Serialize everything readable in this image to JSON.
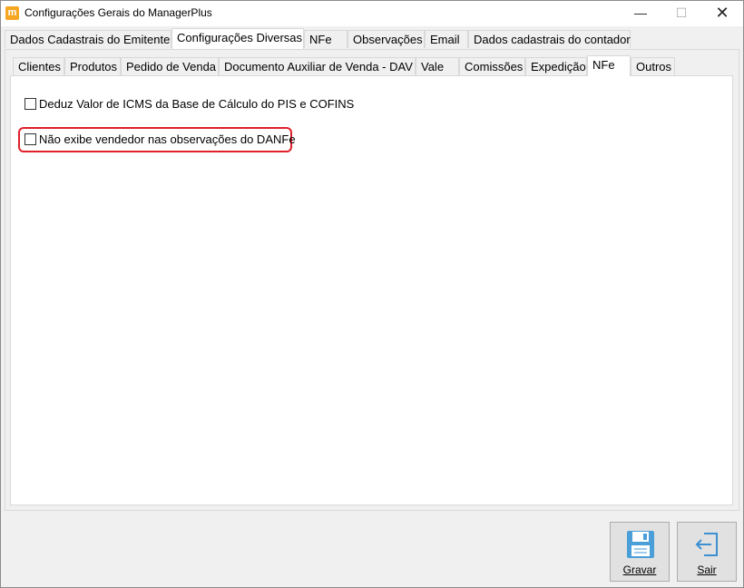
{
  "window": {
    "title": "Configurações Gerais do ManagerPlus",
    "icon": "managerplus-app-icon",
    "controls": [
      "minimize",
      "maximize",
      "close"
    ]
  },
  "main_tabs": [
    {
      "label": "Dados Cadastrais do Emitente",
      "active": false
    },
    {
      "label": "Configurações Diversas",
      "active": true
    },
    {
      "label": "NFe",
      "active": false
    },
    {
      "label": "Observações",
      "active": false
    },
    {
      "label": "Email",
      "active": false
    },
    {
      "label": "Dados cadastrais do contador",
      "active": false
    }
  ],
  "sub_tabs": [
    {
      "label": "Clientes",
      "active": false
    },
    {
      "label": "Produtos",
      "active": false
    },
    {
      "label": "Pedido de Venda",
      "active": false
    },
    {
      "label": "Documento Auxiliar de Venda - DAV",
      "active": false
    },
    {
      "label": "Vale",
      "active": false
    },
    {
      "label": "Comissões",
      "active": false
    },
    {
      "label": "Expedição",
      "active": false
    },
    {
      "label": "NFe",
      "active": true
    },
    {
      "label": "Outros",
      "active": false
    }
  ],
  "options": [
    {
      "label": "Deduz Valor de ICMS da Base de Cálculo do PIS e COFINS",
      "checked": false
    },
    {
      "label": "Não exibe vendedor nas observações do DANFe",
      "checked": false,
      "highlighted": true
    }
  ],
  "buttons": {
    "save": {
      "label": "Gravar",
      "icon": "floppy-disk-icon"
    },
    "exit": {
      "label": "Sair",
      "icon": "exit-door-icon"
    }
  },
  "colors": {
    "highlight": "#e0202a",
    "save_icon": "#4a9fd8",
    "exit_icon": "#3c8fd0"
  }
}
